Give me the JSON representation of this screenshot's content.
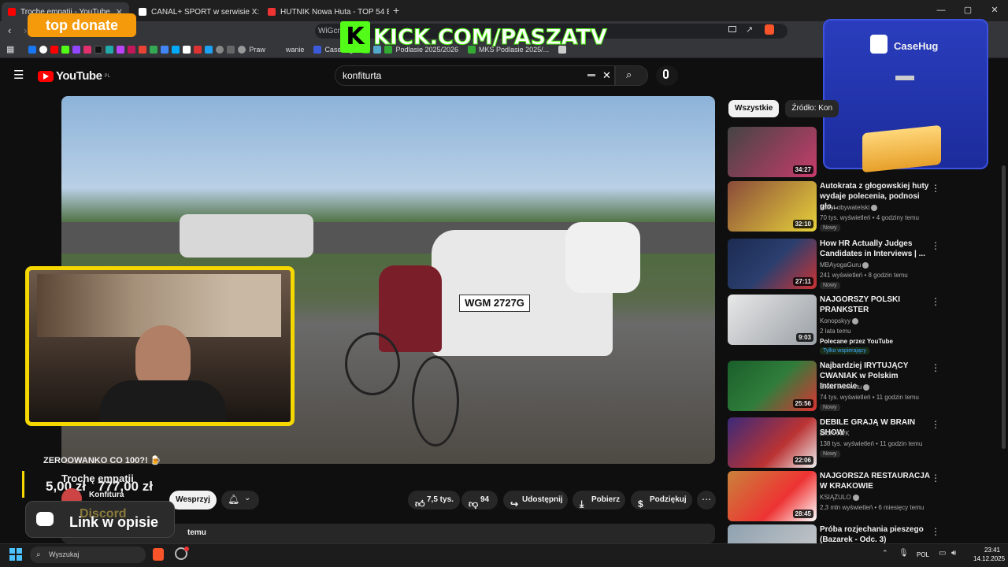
{
  "browser": {
    "tabs": [
      {
        "label": "Trochę empatii - YouTube",
        "color": "#ff0000"
      },
      {
        "label": "CANAL+ SPORT w serwisie X: „CHRA",
        "color": "#ffffff"
      },
      {
        "label": "HUTNIK Nowa Huta - TOP 54 Biała P",
        "color": "#e33"
      }
    ],
    "url_fragment": "WiGcm",
    "bookmarks": [
      "Praw",
      "wanie",
      "Casehug",
      "Podlasie 2025/2026",
      "MKS Podlasie 2025/..."
    ]
  },
  "overlays": {
    "top_donate": "top donate",
    "kick": "KICK.COM/PASZATV",
    "casehug": "CaseHug",
    "donation_message": "ZEROOWANKO CO 100?! 🍺",
    "donation_amount": "5,00 zł",
    "donation_total": "777,00 zł",
    "discord_ghost": "Discord",
    "discord_link": "Link w opisie"
  },
  "youtube": {
    "logo": "YouTube",
    "region": "PL",
    "search_query": "konfiturta",
    "video": {
      "title": "Trochę empatii",
      "channel": "Konfitura",
      "support_label": "Wesprzyj",
      "likes": "7,5 tys.",
      "dislikes": "94",
      "share": "Udostępnij",
      "download": "Pobierz",
      "thanks": "Podziękuj",
      "desc_fragment": "temu"
    },
    "chips": [
      "Wszystkie",
      "Źródło: Kon"
    ],
    "recommendations": [
      {
        "title": "",
        "channel": "",
        "meta": "",
        "duration": "34:27",
        "thumb": "#c73c6c",
        "badge": ""
      },
      {
        "title": "Autokrata z głogowskiej huty wydaje polecenia, podnosi gło...",
        "channel": "audyt obywatelski",
        "meta": "70 tys. wyświetleń • 4 godziny temu",
        "duration": "32:10",
        "thumb": "#8a4b3a",
        "badge": "Nowy"
      },
      {
        "title": "How HR Actually Judges Candidates in Interviews | ...",
        "channel": "MBAyogaGuru",
        "meta": "241 wyświetleń • 8 godzin temu",
        "duration": "27:11",
        "thumb": "#2a3f6e",
        "badge": "Nowy"
      },
      {
        "title": "NAJGORSZY POLSKI PRANKSTER",
        "channel": "Konopskyy",
        "meta": "2 lata temu",
        "extra": "Polecane przez YouTube",
        "members": "Tylko wspierający",
        "duration": "9:03",
        "thumb": "#9aa0a6",
        "badge": ""
      },
      {
        "title": "Najbardziej IRYTUJĄCY CWANIAK w Polskim Internecie",
        "channel": "Świat Internetu",
        "meta": "74 tys. wyświetleń • 11 godzin temu",
        "duration": "25:56",
        "thumb": "#2f7d3b",
        "badge": "Nowy"
      },
      {
        "title": "DEBILE GRAJĄ W BRAIN SHOW",
        "channel": "EKIPA WK",
        "meta": "138 tys. wyświetleń • 11 godzin temu",
        "duration": "22:06",
        "thumb": "#3b2a7a",
        "badge": "Nowy"
      },
      {
        "title": "NAJGORSZA RESTAURACJA W KRAKOWIE",
        "channel": "KSIĄŻULO",
        "meta": "2,3 mln wyświetleń • 6 miesięcy temu",
        "duration": "28:45",
        "thumb": "#c9823b",
        "badge": ""
      },
      {
        "title": "Próba rozjechania pieszego (Bazarek - Odc. 3)",
        "channel": "",
        "meta": "",
        "duration": "",
        "thumb": "#8fa1b0",
        "badge": ""
      }
    ]
  },
  "taskbar": {
    "search_placeholder": "Wyszukaj",
    "lang": "POL",
    "time": "23:41",
    "date": "14.12.2025"
  }
}
